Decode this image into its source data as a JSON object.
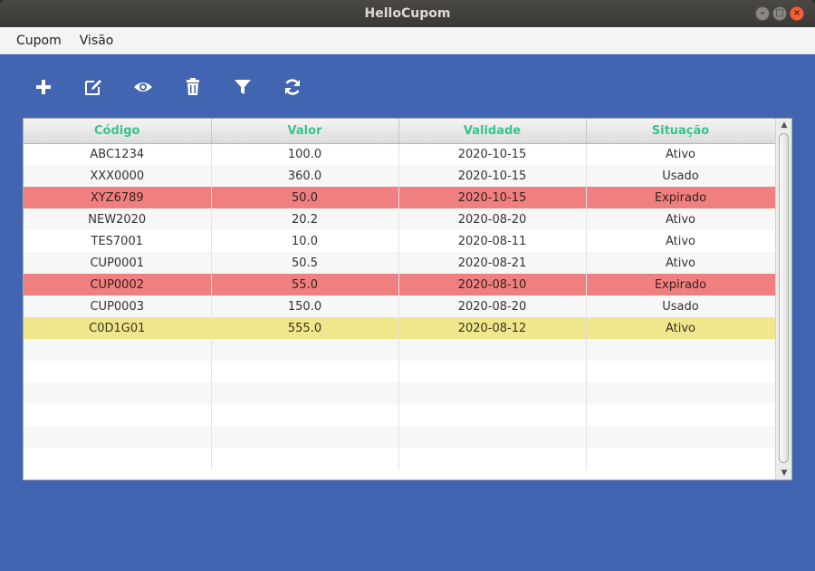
{
  "window": {
    "title": "HelloCupom"
  },
  "menu": {
    "items": [
      "Cupom",
      "Visão"
    ]
  },
  "toolbar": {
    "buttons": [
      {
        "icon": "plus-icon"
      },
      {
        "icon": "edit-icon"
      },
      {
        "icon": "eye-icon"
      },
      {
        "icon": "trash-icon"
      },
      {
        "icon": "filter-icon"
      },
      {
        "icon": "refresh-icon"
      }
    ]
  },
  "colors": {
    "background": "#4165b1",
    "header_text": "#3cc28e",
    "expired_row": "#f08080",
    "highlight_row": "#f0e68c"
  },
  "table": {
    "columns": [
      "Código",
      "Valor",
      "Validade",
      "Situação"
    ],
    "rows": [
      {
        "codigo": "ABC1234",
        "valor": "100.0",
        "validade": "2020-10-15",
        "situacao": "Ativo",
        "state": "normal"
      },
      {
        "codigo": "XXX0000",
        "valor": "360.0",
        "validade": "2020-10-15",
        "situacao": "Usado",
        "state": "normal"
      },
      {
        "codigo": "XYZ6789",
        "valor": "50.0",
        "validade": "2020-10-15",
        "situacao": "Expirado",
        "state": "expired"
      },
      {
        "codigo": "NEW2020",
        "valor": "20.2",
        "validade": "2020-08-20",
        "situacao": "Ativo",
        "state": "normal"
      },
      {
        "codigo": "TES7001",
        "valor": "10.0",
        "validade": "2020-08-11",
        "situacao": "Ativo",
        "state": "normal"
      },
      {
        "codigo": "CUP0001",
        "valor": "50.5",
        "validade": "2020-08-21",
        "situacao": "Ativo",
        "state": "normal"
      },
      {
        "codigo": "CUP0002",
        "valor": "55.0",
        "validade": "2020-08-10",
        "situacao": "Expirado",
        "state": "expired"
      },
      {
        "codigo": "CUP0003",
        "valor": "150.0",
        "validade": "2020-08-20",
        "situacao": "Usado",
        "state": "normal"
      },
      {
        "codigo": "C0D1G01",
        "valor": "555.0",
        "validade": "2020-08-12",
        "situacao": "Ativo",
        "state": "highlight"
      }
    ],
    "empty_rows": 6
  }
}
